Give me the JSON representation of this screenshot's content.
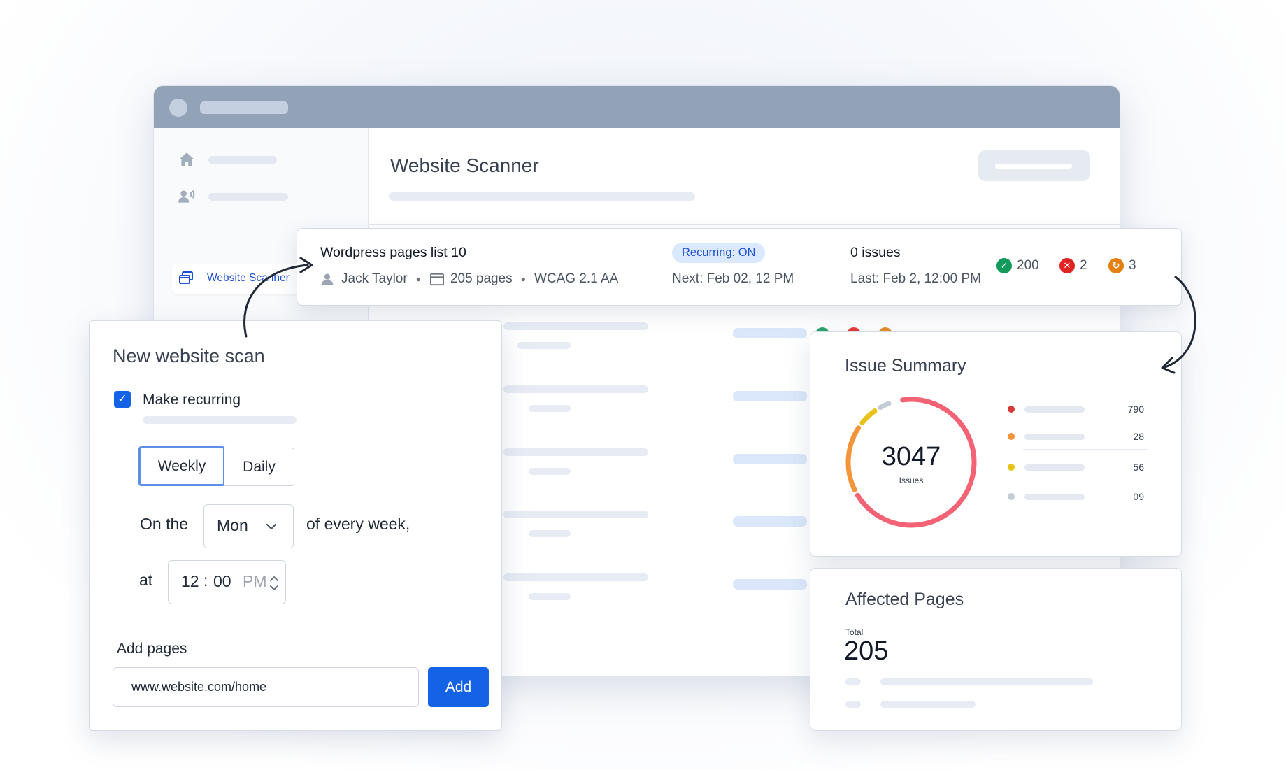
{
  "app": {
    "sidebar": {
      "active_item_label": "Website Scanner"
    },
    "page_title": "Website Scanner"
  },
  "scan_row": {
    "name": "Wordpress pages list 10",
    "owner": "Jack Taylor",
    "pages": "205 pages",
    "standard": "WCAG 2.1 AA",
    "recurring_badge": "Recurring: ON",
    "next_run": "Next: Feb 02, 12 PM",
    "issues": "0 issues",
    "last_run": "Last: Feb 2, 12:00 PM",
    "stats": {
      "passed": "200",
      "failed": "2",
      "pending": "3"
    }
  },
  "new_scan": {
    "title": "New website scan",
    "recurring_label": "Make recurring",
    "recurring_checked": true,
    "frequency_options": [
      "Weekly",
      "Daily"
    ],
    "frequency_selected": "Weekly",
    "on_the_label": "On the",
    "day_value": "Mon",
    "of_every_week_label": "of every week,",
    "at_label": "at",
    "time": {
      "hour": "12",
      "separator": ":",
      "minute": "00",
      "period": "PM"
    },
    "add_pages_label": "Add pages",
    "url_value": "www.website.com/home",
    "add_button_label": "Add"
  },
  "issue_summary": {
    "title": "Issue Summary",
    "total": "3047",
    "total_label": "Issues",
    "legend": [
      {
        "value": "790",
        "color": "#d63b3b"
      },
      {
        "value": "28",
        "color": "#f5953b"
      },
      {
        "value": "56",
        "color": "#e7c21a"
      },
      {
        "value": "09",
        "color": "#c4ccd6"
      }
    ],
    "ring_segments": [
      {
        "fraction": 0.7,
        "color": "#f36375"
      },
      {
        "fraction": 0.18,
        "color": "#f5953b"
      },
      {
        "fraction": 0.06,
        "color": "#e7c21a"
      },
      {
        "fraction": 0.04,
        "color": "#c4ccd6"
      }
    ]
  },
  "affected_pages": {
    "title": "Affected Pages",
    "total_label": "Total",
    "total": "205"
  },
  "colors": {
    "accent": "#1462e6",
    "badge_bg": "#dbe9fe",
    "passed": "#139a5a",
    "failed": "#e02424",
    "pending": "#e57f10"
  },
  "icons": [
    "home-icon",
    "users-icon",
    "website-scanner-icon",
    "user-icon",
    "calendar-icon",
    "check-circle-icon",
    "x-circle-icon",
    "refresh-circle-icon",
    "chevron-down-icon",
    "stepper-icon",
    "checkbox-check-icon"
  ]
}
